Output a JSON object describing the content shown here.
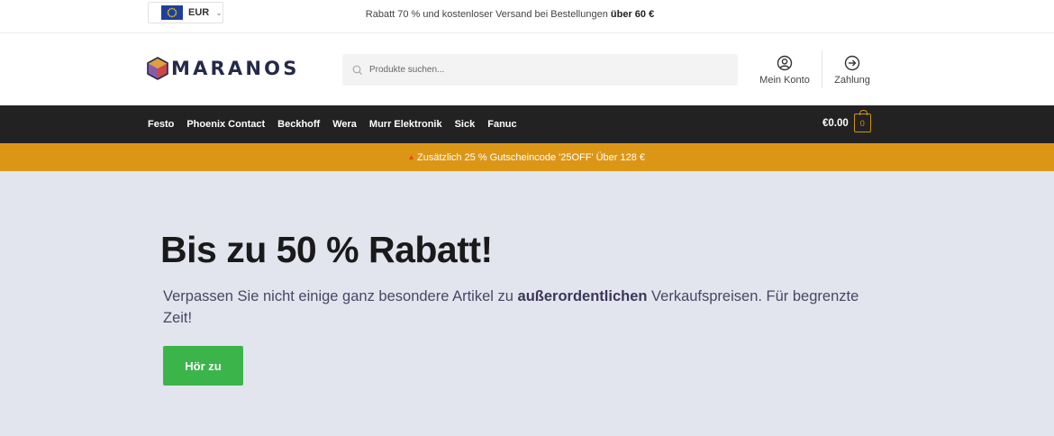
{
  "topbar": {
    "currency": "EUR",
    "promo_prefix": "Rabatt 70 % und kostenloser Versand bei Bestellungen",
    "promo_bold": "über 60 €"
  },
  "header": {
    "logo_text": "MARANOS",
    "search_placeholder": "Produkte suchen...",
    "account_label": "Mein Konto",
    "checkout_label": "Zahlung"
  },
  "nav": {
    "items": [
      {
        "label": "Festo"
      },
      {
        "label": "Phoenix Contact"
      },
      {
        "label": "Beckhoff"
      },
      {
        "label": "Wera"
      },
      {
        "label": "Murr Elektronik"
      },
      {
        "label": "Sick"
      },
      {
        "label": "Fanuc"
      }
    ],
    "cart_total": "€0.00",
    "cart_count": "0"
  },
  "coupon": {
    "text": "Zusätzlich 25 % Gutscheincode '25OFF' Über 128 €"
  },
  "hero": {
    "title": "Bis zu 50 % Rabatt!",
    "desc_prefix": "Verpassen Sie nicht einige ganz besondere Artikel zu ",
    "desc_bold": "außerordentlichen",
    "desc_suffix": " Verkaufspreisen. Für begrenzte Zeit!",
    "button_label": "Hör zu"
  },
  "colors": {
    "nav_bg": "#222222",
    "accent_orange": "#dc9616",
    "hero_bg": "#e3e5ee",
    "button_green": "#3bb54a",
    "logo_navy": "#252a4a"
  },
  "icons": {
    "currency_flag": "eu-flag-icon",
    "currency_dropdown": "chevron-down-icon",
    "search": "search-icon",
    "account": "user-circle-icon",
    "checkout": "arrow-right-circle-icon",
    "cart": "shopping-bag-icon",
    "coupon": "fire-icon"
  }
}
